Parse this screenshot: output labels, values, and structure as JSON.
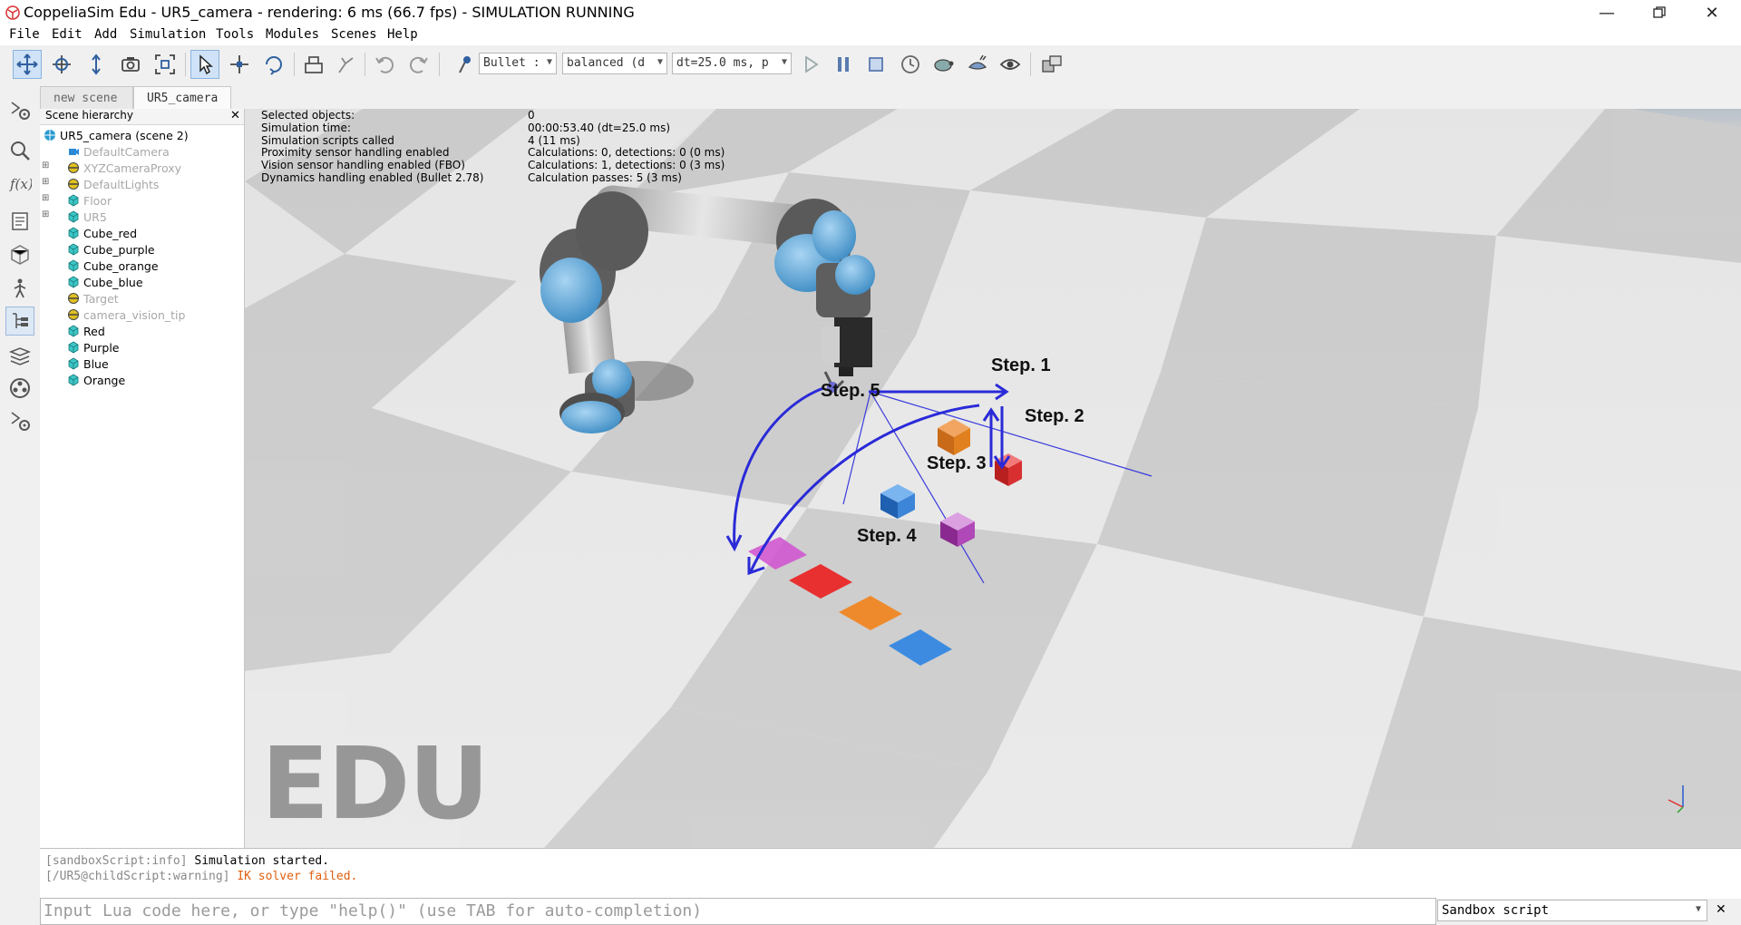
{
  "window": {
    "title": "CoppeliaSim Edu - UR5_camera - rendering: 6 ms (66.7 fps) - SIMULATION RUNNING",
    "minimize_icon": "minimize-icon",
    "maximize_icon": "restore-icon",
    "close_icon": "close-icon"
  },
  "menu": [
    "File",
    "Edit",
    "Add",
    "Simulation",
    "Tools",
    "Modules",
    "Scenes",
    "Help"
  ],
  "toolbar": {
    "engine": "Bullet :",
    "accuracy": "balanced (d",
    "timestep": "dt=25.0 ms, p"
  },
  "tabs": [
    "new scene",
    "UR5_camera"
  ],
  "hierarchy": {
    "header": "Scene hierarchy",
    "items": [
      {
        "label": "UR5_camera (scene 2)",
        "icon": "scene-icon"
      },
      {
        "label": "DefaultCamera",
        "icon": "camera-icon"
      },
      {
        "label": "XYZCameraProxy",
        "icon": "dummy-icon"
      },
      {
        "label": "DefaultLights",
        "icon": "dummy-icon"
      },
      {
        "label": "Floor",
        "icon": "shape-icon"
      },
      {
        "label": "UR5",
        "icon": "shape-icon"
      },
      {
        "label": "Cube_red",
        "icon": "shape-icon"
      },
      {
        "label": "Cube_purple",
        "icon": "shape-icon"
      },
      {
        "label": "Cube_orange",
        "icon": "shape-icon"
      },
      {
        "label": "Cube_blue",
        "icon": "shape-icon"
      },
      {
        "label": "Target",
        "icon": "dummy-icon"
      },
      {
        "label": "camera_vision_tip",
        "icon": "dummy-icon"
      },
      {
        "label": "Red",
        "icon": "shape-icon"
      },
      {
        "label": "Purple",
        "icon": "shape-icon"
      },
      {
        "label": "Blue",
        "icon": "shape-icon"
      },
      {
        "label": "Orange",
        "icon": "shape-icon"
      }
    ]
  },
  "info": {
    "labels": [
      "Selected objects:",
      "Simulation time:",
      "Simulation scripts called",
      "Proximity sensor handling enabled",
      "Vision sensor handling enabled (FBO)",
      "Dynamics handling enabled (Bullet 2.78)"
    ],
    "values": [
      "0",
      "00:00:53.40 (dt=25.0 ms)",
      "4 (11 ms)",
      "Calculations: 0, detections: 0 (0 ms)",
      "Calculations: 1, detections: 0 (3 ms)",
      "Calculation passes: 5 (3 ms)"
    ]
  },
  "steps": [
    "Step. 1",
    "Step. 2",
    "Step. 3",
    "Step. 4",
    "Step. 5"
  ],
  "watermark": "EDU",
  "console": {
    "line1_prefix": "[sandboxScript:info]",
    "line1_text": "Simulation started.",
    "line2_prefix": "[/UR5@childScript:warning]",
    "line2_text": "IK solver failed."
  },
  "command": {
    "placeholder": "Input Lua code here, or type \"help()\" (use TAB for auto-completion)",
    "script_selector": "Sandbox script"
  },
  "colors": {
    "cube_red": "#e83a3a",
    "cube_purple": "#b04ab8",
    "cube_orange": "#ee8a2c",
    "cube_blue": "#3d8be0",
    "arrow_blue": "#2a2ad8",
    "warning": "#e06010"
  }
}
